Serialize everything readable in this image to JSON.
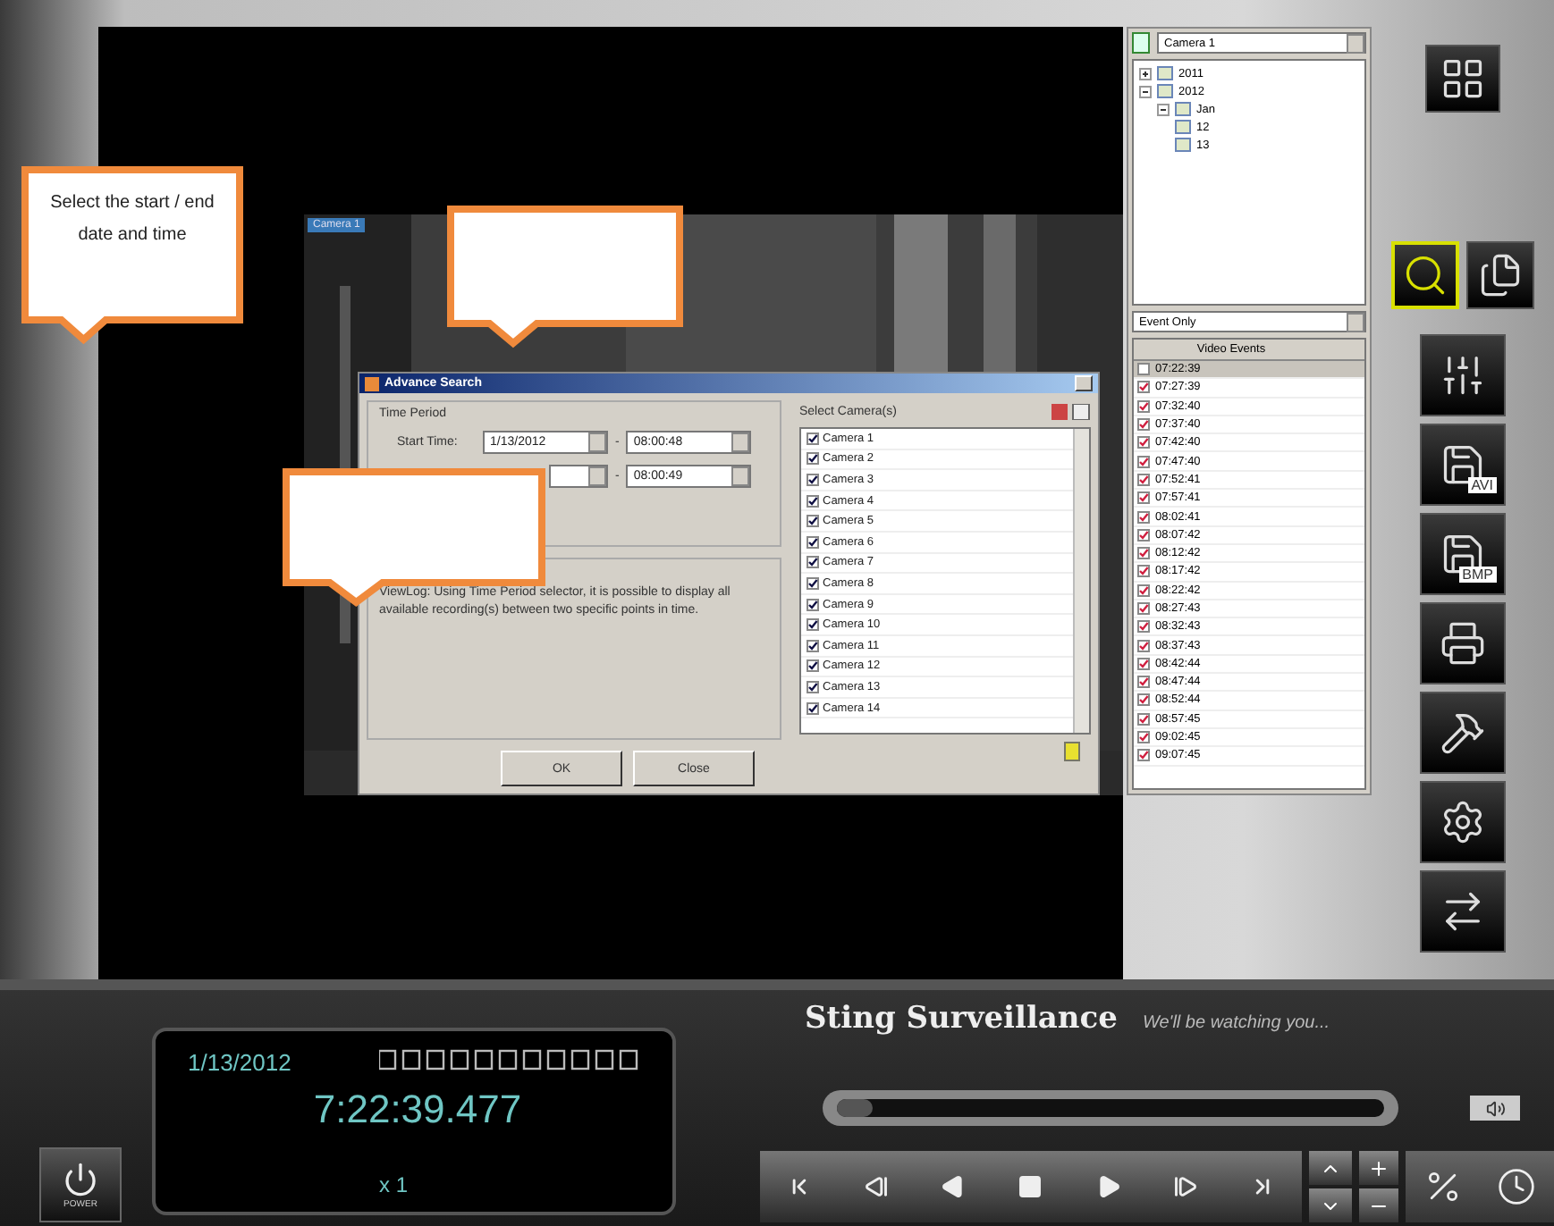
{
  "video": {
    "camera_label": "Camera 1"
  },
  "dialog": {
    "title": "Advance Search",
    "group_label": "Time Period",
    "start_label": "Start Time:",
    "start_date": "1/13/2012",
    "start_time": "08:00:48",
    "separator": "-",
    "end_time": "08:00:49",
    "description": "ViewLog: Using Time Period selector, it is possible to display all available recording(s) between two specific points in time.",
    "cameras_label": "Select Camera(s)",
    "cameras": [
      {
        "label": "Camera 1",
        "checked": true
      },
      {
        "label": "Camera 2",
        "checked": true
      },
      {
        "label": "Camera 3",
        "checked": true
      },
      {
        "label": "Camera 4",
        "checked": true
      },
      {
        "label": "Camera 5",
        "checked": true
      },
      {
        "label": "Camera 6",
        "checked": true
      },
      {
        "label": "Camera 7",
        "checked": true
      },
      {
        "label": "Camera 8",
        "checked": true
      },
      {
        "label": "Camera 9",
        "checked": true
      },
      {
        "label": "Camera 10",
        "checked": true
      },
      {
        "label": "Camera 11",
        "checked": true
      },
      {
        "label": "Camera 12",
        "checked": true
      },
      {
        "label": "Camera 13",
        "checked": true
      },
      {
        "label": "Camera 14",
        "checked": true
      }
    ],
    "buttons": [
      "OK",
      "Close"
    ]
  },
  "callouts": [
    {
      "kind": "note",
      "text": "Select the start / end date and time"
    },
    {
      "kind": "blank"
    },
    {
      "kind": "blank"
    }
  ],
  "side_panel": {
    "camera_select": "Camera 1",
    "tree": [
      {
        "label": "2011",
        "expanded": false
      },
      {
        "label": "2012",
        "expanded": true,
        "children": [
          {
            "label": "Jan",
            "expanded": true,
            "children": [
              {
                "label": "12"
              },
              {
                "label": "13"
              }
            ]
          }
        ]
      }
    ],
    "filter": "Event Only",
    "events_header": "Video Events",
    "events": [
      {
        "time": "07:22:39",
        "checked": false,
        "selected": true
      },
      {
        "time": "07:27:39",
        "checked": true,
        "selected": false
      },
      {
        "time": "07:32:40",
        "checked": true,
        "selected": false
      },
      {
        "time": "07:37:40",
        "checked": true,
        "selected": false
      },
      {
        "time": "07:42:40",
        "checked": true,
        "selected": false
      },
      {
        "time": "07:47:40",
        "checked": true,
        "selected": false
      },
      {
        "time": "07:52:41",
        "checked": true,
        "selected": false
      },
      {
        "time": "07:57:41",
        "checked": true,
        "selected": false
      },
      {
        "time": "08:02:41",
        "checked": true,
        "selected": false
      },
      {
        "time": "08:07:42",
        "checked": true,
        "selected": false
      },
      {
        "time": "08:12:42",
        "checked": true,
        "selected": false
      },
      {
        "time": "08:17:42",
        "checked": true,
        "selected": false
      },
      {
        "time": "08:22:42",
        "checked": true,
        "selected": false
      },
      {
        "time": "08:27:43",
        "checked": true,
        "selected": false
      },
      {
        "time": "08:32:43",
        "checked": true,
        "selected": false
      },
      {
        "time": "08:37:43",
        "checked": true,
        "selected": false
      },
      {
        "time": "08:42:44",
        "checked": true,
        "selected": false
      },
      {
        "time": "08:47:44",
        "checked": true,
        "selected": false
      },
      {
        "time": "08:52:44",
        "checked": true,
        "selected": false
      },
      {
        "time": "08:57:45",
        "checked": true,
        "selected": false
      },
      {
        "time": "09:02:45",
        "checked": true,
        "selected": false
      },
      {
        "time": "09:07:45",
        "checked": true,
        "selected": false
      }
    ]
  },
  "tools": [
    {
      "kind": "grid",
      "active": false
    },
    {
      "kind": "search",
      "active": true
    },
    {
      "kind": "list",
      "active": false
    },
    {
      "kind": "mixer",
      "active": false
    },
    {
      "kind": "save",
      "label": "AVI",
      "active": false
    },
    {
      "kind": "save",
      "label": "BMP",
      "active": false
    },
    {
      "kind": "print",
      "active": false
    },
    {
      "kind": "tools",
      "active": false
    },
    {
      "kind": "settings",
      "active": false
    },
    {
      "kind": "transfer",
      "active": false
    }
  ],
  "player": {
    "power_label": "POWER",
    "date": "1/13/2012",
    "time": "7:22:39.477",
    "speed": "x 1",
    "brand": "Sting Surveillance",
    "tagline": "We'll be watching you...",
    "progress": {
      "level": 0.03
    }
  }
}
